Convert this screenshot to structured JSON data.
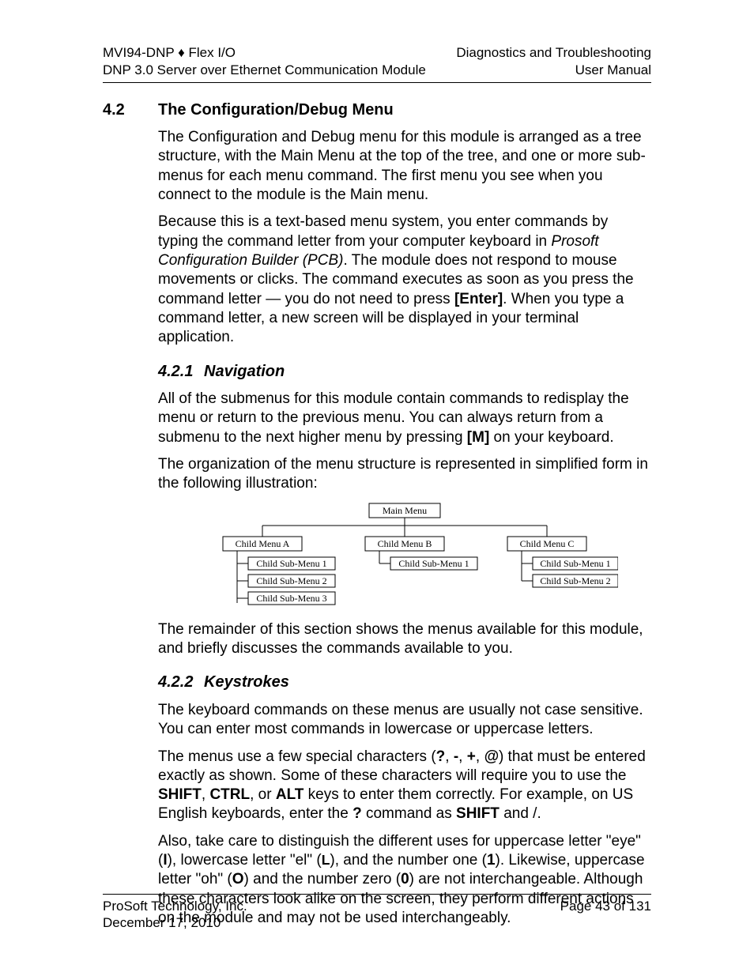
{
  "header": {
    "left1": "MVI94-DNP ♦ Flex I/O",
    "left2": "DNP 3.0 Server over Ethernet Communication Module",
    "right1": "Diagnostics and Troubleshooting",
    "right2": "User Manual"
  },
  "sec42": {
    "num": "4.2",
    "title": "The Configuration/Debug Menu",
    "p1": "The Configuration and Debug menu for this module is arranged as a tree structure, with the Main Menu at the top of the tree, and one or more sub-menus for each menu command. The first menu you see when you connect to the module is the Main menu.",
    "p2a": "Because this is a text-based menu system, you enter commands by typing the command letter from your computer keyboard in ",
    "p2b": "Prosoft Configuration Builder (PCB)",
    "p2c": ". The module does not respond to mouse movements or clicks. The command executes as soon as you press the command letter — you do not need to press ",
    "p2d": "[Enter]",
    "p2e": ". When you type a command letter, a new screen will be displayed in your terminal application."
  },
  "sec421": {
    "num": "4.2.1",
    "title": "Navigation",
    "p1a": "All of the submenus for this module contain commands to redisplay the menu or return to the previous menu. You can always return from a submenu to the next higher menu by pressing ",
    "p1b": "[M]",
    "p1c": " on your keyboard.",
    "p2": "The organization of the menu structure is represented in simplified form in the following illustration:",
    "p3": "The remainder of this section shows the menus available for this module, and briefly discusses the commands available to you."
  },
  "tree": {
    "root": "Main Menu",
    "a": "Child Menu A",
    "a1": "Child Sub-Menu 1",
    "a2": "Child Sub-Menu 2",
    "a3": "Child Sub-Menu 3",
    "b": "Child Menu B",
    "b1": "Child Sub-Menu 1",
    "c": "Child Menu C",
    "c1": "Child Sub-Menu 1",
    "c2": "Child Sub-Menu 2"
  },
  "sec422": {
    "num": "4.2.2",
    "title": "Keystrokes",
    "p1": "The keyboard commands on these menus are usually not case sensitive. You can enter most commands in lowercase or uppercase letters.",
    "p2a": "The menus use a few special characters (",
    "p2q": "?",
    "p2sep": ", ",
    "p2dash": "-",
    "p2plus": "+",
    "p2at": "@",
    "p2b": ") that must be entered exactly as shown. Some of these characters will require you to use the ",
    "p2shift": "SHIFT",
    "p2ctrl": "CTRL",
    "p2or": ", or ",
    "p2alt": "ALT",
    "p2c": " keys to enter them correctly. For example, on US English keyboards, enter the ",
    "p2q2": "?",
    "p2d": " command as ",
    "p2shift2": "SHIFT",
    "p2e": " and /.",
    "p3a": "Also, take care to distinguish the different uses for uppercase letter \"eye\" (",
    "p3I": "I",
    "p3b": "), lowercase letter \"el\" (",
    "p3L": "L",
    "p3c": "), and the number one (",
    "p3one": "1",
    "p3d": ").   Likewise, uppercase letter \"oh\" (",
    "p3O": "O",
    "p3e": ") and the number zero (",
    "p3zero": "0",
    "p3f": ") are not interchangeable. Although these characters look alike on the screen, they perform different actions on the module and may not be used interchangeably."
  },
  "footer": {
    "left1": "ProSoft Technology, Inc.",
    "left2": "December 17, 2010",
    "right1": "Page 43 of 131"
  }
}
